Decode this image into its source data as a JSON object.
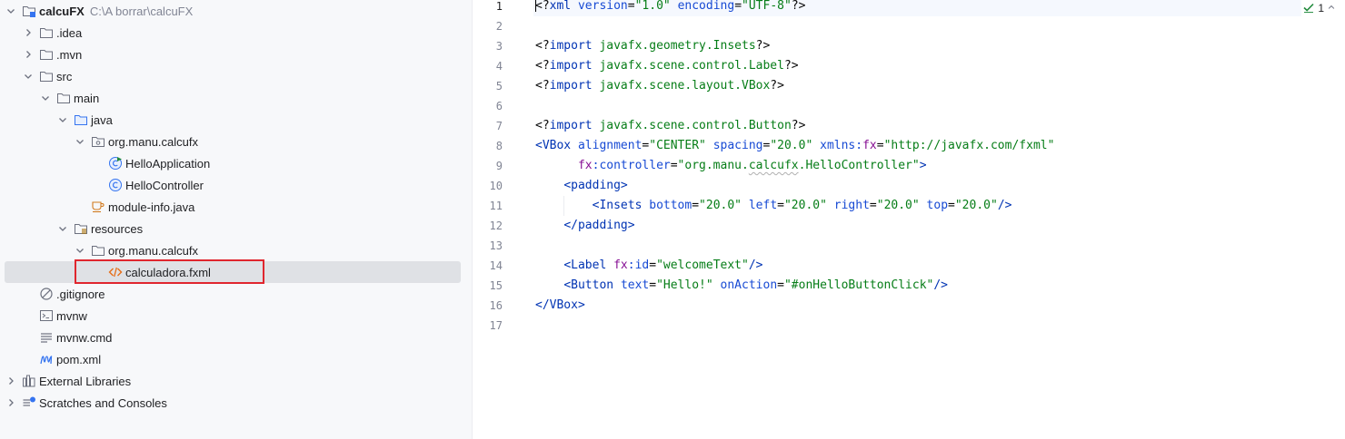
{
  "project_tree": {
    "items": [
      {
        "id": "calcufx",
        "label": "calcuFX",
        "path": "C:\\A borrar\\calcuFX",
        "depth": 0,
        "expand": "open",
        "icon": "module-folder-icon",
        "bold": true
      },
      {
        "id": "idea",
        "label": ".idea",
        "depth": 1,
        "expand": "closed",
        "icon": "folder-icon"
      },
      {
        "id": "mvn",
        "label": ".mvn",
        "depth": 1,
        "expand": "closed",
        "icon": "folder-icon"
      },
      {
        "id": "src",
        "label": "src",
        "depth": 1,
        "expand": "open",
        "icon": "folder-icon"
      },
      {
        "id": "main",
        "label": "main",
        "depth": 2,
        "expand": "open",
        "icon": "folder-icon"
      },
      {
        "id": "java",
        "label": "java",
        "depth": 3,
        "expand": "open",
        "icon": "source-folder-icon"
      },
      {
        "id": "pkg-java",
        "label": "org.manu.calcufx",
        "depth": 4,
        "expand": "open",
        "icon": "package-icon"
      },
      {
        "id": "helloapp",
        "label": "HelloApplication",
        "depth": 5,
        "expand": "none",
        "icon": "application-class-icon"
      },
      {
        "id": "hellocontroller",
        "label": "HelloController",
        "depth": 5,
        "expand": "none",
        "icon": "class-icon"
      },
      {
        "id": "moduleinfo",
        "label": "module-info.java",
        "depth": 4,
        "expand": "none",
        "icon": "module-info-icon"
      },
      {
        "id": "resources",
        "label": "resources",
        "depth": 3,
        "expand": "open",
        "icon": "resources-folder-icon"
      },
      {
        "id": "pkg-res",
        "label": "org.manu.calcufx",
        "depth": 4,
        "expand": "open",
        "icon": "folder-icon"
      },
      {
        "id": "calcfxml",
        "label": "calculadora.fxml",
        "depth": 5,
        "expand": "none",
        "icon": "fxml-file-icon",
        "selected": true
      },
      {
        "id": "gitignore",
        "label": ".gitignore",
        "depth": 1,
        "expand": "none",
        "icon": "ignore-file-icon"
      },
      {
        "id": "mvnw",
        "label": "mvnw",
        "depth": 1,
        "expand": "none",
        "icon": "shell-script-icon"
      },
      {
        "id": "mvnwcmd",
        "label": "mvnw.cmd",
        "depth": 1,
        "expand": "none",
        "icon": "text-file-icon"
      },
      {
        "id": "pom",
        "label": "pom.xml",
        "depth": 1,
        "expand": "none",
        "icon": "maven-icon"
      },
      {
        "id": "extlib",
        "label": "External Libraries",
        "depth": 0,
        "expand": "closed",
        "icon": "libraries-icon"
      },
      {
        "id": "scratches",
        "label": "Scratches and Consoles",
        "depth": 0,
        "expand": "closed",
        "icon": "scratches-icon"
      }
    ]
  },
  "editor": {
    "current_line": 1,
    "inspection": {
      "count": "1",
      "icon": "check-inspection-icon",
      "arrow": "chevron-up-icon"
    },
    "lines": [
      {
        "n": "1",
        "tokens": [
          {
            "t": "pi",
            "v": "<?"
          },
          {
            "t": "tag",
            "v": "xml "
          },
          {
            "t": "attr",
            "v": "version"
          },
          {
            "t": "pl",
            "v": "="
          },
          {
            "t": "val",
            "v": "\"1.0\""
          },
          {
            "t": "pl",
            "v": " "
          },
          {
            "t": "attr",
            "v": "encoding"
          },
          {
            "t": "pl",
            "v": "="
          },
          {
            "t": "val",
            "v": "\"UTF-8\""
          },
          {
            "t": "pi",
            "v": "?>"
          }
        ]
      },
      {
        "n": "2",
        "tokens": []
      },
      {
        "n": "3",
        "tokens": [
          {
            "t": "pi",
            "v": "<?"
          },
          {
            "t": "tag",
            "v": "import"
          },
          {
            "t": "pl",
            "v": " "
          },
          {
            "t": "val",
            "v": "javafx.geometry.Insets"
          },
          {
            "t": "pi",
            "v": "?>"
          }
        ]
      },
      {
        "n": "4",
        "tokens": [
          {
            "t": "pi",
            "v": "<?"
          },
          {
            "t": "tag",
            "v": "import"
          },
          {
            "t": "pl",
            "v": " "
          },
          {
            "t": "val",
            "v": "javafx.scene.control.Label"
          },
          {
            "t": "pi",
            "v": "?>"
          }
        ]
      },
      {
        "n": "5",
        "tokens": [
          {
            "t": "pi",
            "v": "<?"
          },
          {
            "t": "tag",
            "v": "import"
          },
          {
            "t": "pl",
            "v": " "
          },
          {
            "t": "val",
            "v": "javafx.scene.layout.VBox"
          },
          {
            "t": "pi",
            "v": "?>"
          }
        ]
      },
      {
        "n": "6",
        "tokens": []
      },
      {
        "n": "7",
        "tokens": [
          {
            "t": "pi",
            "v": "<?"
          },
          {
            "t": "tag",
            "v": "import"
          },
          {
            "t": "pl",
            "v": " "
          },
          {
            "t": "val",
            "v": "javafx.scene.control.Button"
          },
          {
            "t": "pi",
            "v": "?>"
          }
        ]
      },
      {
        "n": "8",
        "tokens": [
          {
            "t": "tag",
            "v": "<VBox"
          },
          {
            "t": "pl",
            "v": " "
          },
          {
            "t": "attr",
            "v": "alignment"
          },
          {
            "t": "pl",
            "v": "="
          },
          {
            "t": "val",
            "v": "\"CENTER\""
          },
          {
            "t": "pl",
            "v": " "
          },
          {
            "t": "attr",
            "v": "spacing"
          },
          {
            "t": "pl",
            "v": "="
          },
          {
            "t": "val",
            "v": "\"20.0\""
          },
          {
            "t": "pl",
            "v": " "
          },
          {
            "t": "attr",
            "v": "xmlns:"
          },
          {
            "t": "ns",
            "v": "fx"
          },
          {
            "t": "pl",
            "v": "="
          },
          {
            "t": "val",
            "v": "\"http://javafx.com/fxml\""
          }
        ]
      },
      {
        "n": "9",
        "tokens": [
          {
            "t": "pl",
            "v": "      "
          },
          {
            "t": "ns",
            "v": "fx"
          },
          {
            "t": "attr",
            "v": ":controller"
          },
          {
            "t": "pl",
            "v": "="
          },
          {
            "t": "val",
            "v": "\"org.manu."
          },
          {
            "t": "valw",
            "v": "calcufx"
          },
          {
            "t": "val",
            "v": ".HelloController\""
          },
          {
            "t": "tag",
            "v": ">"
          }
        ]
      },
      {
        "n": "10",
        "tokens": [
          {
            "t": "pl",
            "v": "    "
          },
          {
            "t": "tag",
            "v": "<padding>"
          }
        ]
      },
      {
        "n": "11",
        "tokens": [
          {
            "t": "pl",
            "v": "        "
          },
          {
            "t": "tag",
            "v": "<Insets"
          },
          {
            "t": "pl",
            "v": " "
          },
          {
            "t": "attr",
            "v": "bottom"
          },
          {
            "t": "pl",
            "v": "="
          },
          {
            "t": "val",
            "v": "\"20.0\""
          },
          {
            "t": "pl",
            "v": " "
          },
          {
            "t": "attr",
            "v": "left"
          },
          {
            "t": "pl",
            "v": "="
          },
          {
            "t": "val",
            "v": "\"20.0\""
          },
          {
            "t": "pl",
            "v": " "
          },
          {
            "t": "attr",
            "v": "right"
          },
          {
            "t": "pl",
            "v": "="
          },
          {
            "t": "val",
            "v": "\"20.0\""
          },
          {
            "t": "pl",
            "v": " "
          },
          {
            "t": "attr",
            "v": "top"
          },
          {
            "t": "pl",
            "v": "="
          },
          {
            "t": "val",
            "v": "\"20.0\""
          },
          {
            "t": "tag",
            "v": "/>"
          }
        ]
      },
      {
        "n": "12",
        "tokens": [
          {
            "t": "pl",
            "v": "    "
          },
          {
            "t": "tag",
            "v": "</padding>"
          }
        ]
      },
      {
        "n": "13",
        "tokens": []
      },
      {
        "n": "14",
        "tokens": [
          {
            "t": "pl",
            "v": "    "
          },
          {
            "t": "tag",
            "v": "<Label"
          },
          {
            "t": "pl",
            "v": " "
          },
          {
            "t": "ns",
            "v": "fx"
          },
          {
            "t": "attr",
            "v": ":id"
          },
          {
            "t": "pl",
            "v": "="
          },
          {
            "t": "val",
            "v": "\"welcomeText\""
          },
          {
            "t": "tag",
            "v": "/>"
          }
        ]
      },
      {
        "n": "15",
        "tokens": [
          {
            "t": "pl",
            "v": "    "
          },
          {
            "t": "tag",
            "v": "<Button"
          },
          {
            "t": "pl",
            "v": " "
          },
          {
            "t": "attr",
            "v": "text"
          },
          {
            "t": "pl",
            "v": "="
          },
          {
            "t": "val",
            "v": "\"Hello!\""
          },
          {
            "t": "pl",
            "v": " "
          },
          {
            "t": "attr",
            "v": "onAction"
          },
          {
            "t": "pl",
            "v": "="
          },
          {
            "t": "val",
            "v": "\"#onHelloButtonClick\""
          },
          {
            "t": "tag",
            "v": "/>"
          }
        ]
      },
      {
        "n": "16",
        "tokens": [
          {
            "t": "tag",
            "v": "</VBox>"
          }
        ]
      },
      {
        "n": "17",
        "tokens": []
      }
    ]
  },
  "colors": {
    "selection": "#dfe1e5",
    "highlight_box": "#e0262e",
    "tag": "#0033b3",
    "string": "#067d17",
    "namespace": "#871094"
  }
}
